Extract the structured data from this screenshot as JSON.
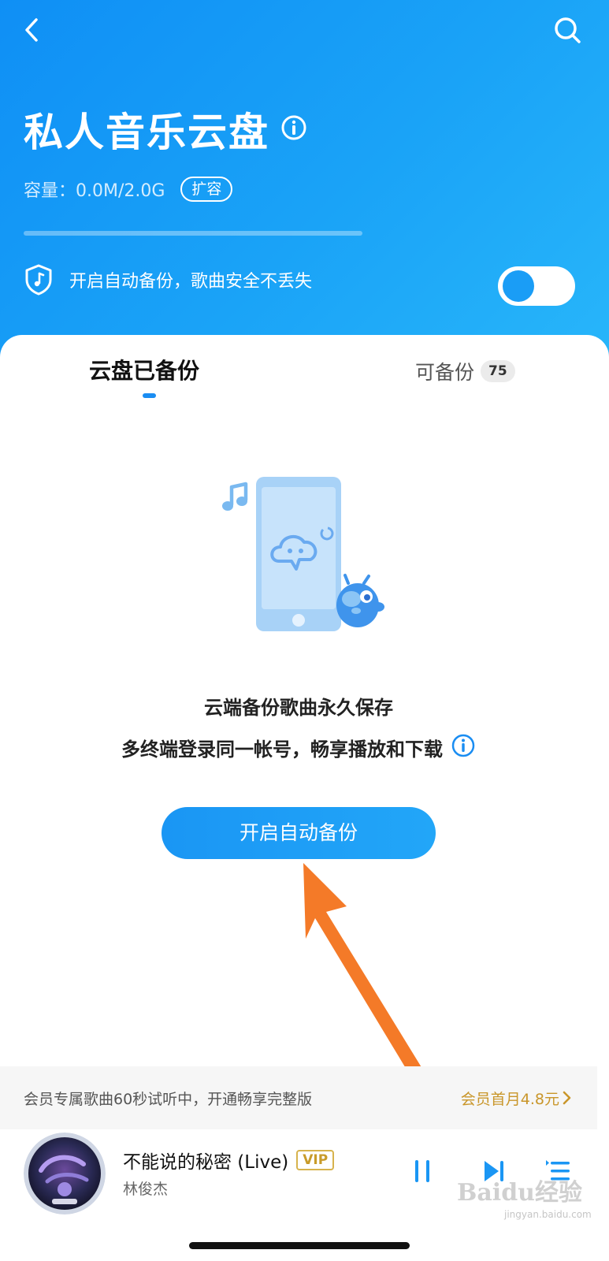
{
  "header": {
    "title": "私人音乐云盘",
    "capacity": "容量：0.0M/2.0G",
    "expand_label": "扩容",
    "storage_used_fraction": 0.0,
    "backup_prompt": "开启自动备份，歌曲安全不丢失",
    "auto_backup_enabled": false,
    "icons": [
      "back-chevron-icon",
      "search-icon",
      "info-icon",
      "shield-music-icon"
    ]
  },
  "tabs": [
    {
      "label": "云盘已备份",
      "active": true
    },
    {
      "label": "可备份",
      "count": "75",
      "active": false
    }
  ],
  "empty_state": {
    "headline": "云端备份歌曲永久保存",
    "subline": "多终端登录同一帐号，畅享播放和下载",
    "button_label": "开启自动备份"
  },
  "promo": {
    "text": "会员专属歌曲60秒试听中，开通畅享完整版",
    "link": "会员首月4.8元"
  },
  "player": {
    "title": "不能说的秘密 (Live)",
    "badge": "VIP",
    "artist": "林俊杰",
    "controls": [
      "pause-icon",
      "next-track-icon",
      "playlist-icon"
    ]
  },
  "watermark": {
    "brand": "Baidu经验",
    "url": "jingyan.baidu.com"
  },
  "colors": {
    "header_blue": "#1aa3f7",
    "accent_blue": "#1a96f4",
    "annotation_orange": "#f47a28",
    "vip_gold": "#c89b2a"
  }
}
